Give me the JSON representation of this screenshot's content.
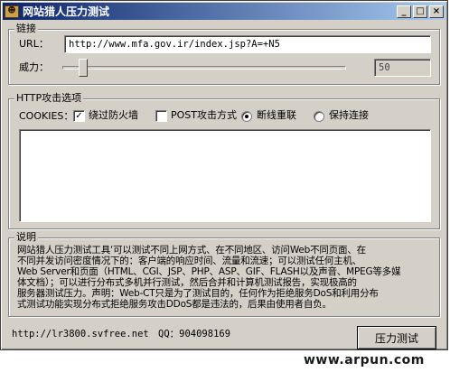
{
  "window": {
    "title": "网站猎人压力测试",
    "icon": "hunter-app-icon",
    "controls": {
      "minimize": "_",
      "maximize": "□",
      "close": "×"
    }
  },
  "link_group": {
    "title": "链接",
    "url_label": "URL：",
    "url_value": "http://www.mfa.gov.ir/index.jsp?A=+N5",
    "power_label": "威力：",
    "power_value": "50",
    "power_slider_fraction": 0.06
  },
  "http_group": {
    "title": "HTTP攻击选项",
    "cookies_label": "COOKIES：",
    "option_firewall": {
      "label": "绕过防火墙",
      "checked": true
    },
    "option_post": {
      "label": "POST攻击方式",
      "checked": false
    },
    "option_reconnect": {
      "label": "断线重联",
      "selected": true
    },
    "option_keepalive": {
      "label": "保持连接",
      "selected": false
    },
    "log_text": ""
  },
  "description_group": {
    "title": "说明",
    "lines": [
      "网站猎人压力测试工具‘可以测试不同上网方式、在不同地区、访问Web不同页面、在",
      "不同并发访问密度情况下的：客户端的响应时间、流量和流速；可以测试任何主机、",
      "Web Server和页面（HTML、CGI、JSP、PHP、ASP、GIF、FLASH以及声音、MPEG等多媒",
      "体文档）；可以进行分布式多机并行测试，然后合并和计算机测试报告，实现极高的",
      "服务器测试压力。声明：Web-CT只是为了测试目的，任何作为拒绝服务DoS和利用分布",
      "式测试功能实现分布式拒绝服务攻击DDoS都是违法的，后果由使用者自负。"
    ]
  },
  "footer": {
    "homepage": "http://lr3800.svfree.net",
    "qq": "QQ：904098169",
    "test_button": "压力测试"
  },
  "watermark": "www.arpun.com",
  "colors": {
    "title_gradient_start": "#0a246a",
    "title_gradient_end": "#a6caf0",
    "window_face": "#d4d0c8"
  }
}
